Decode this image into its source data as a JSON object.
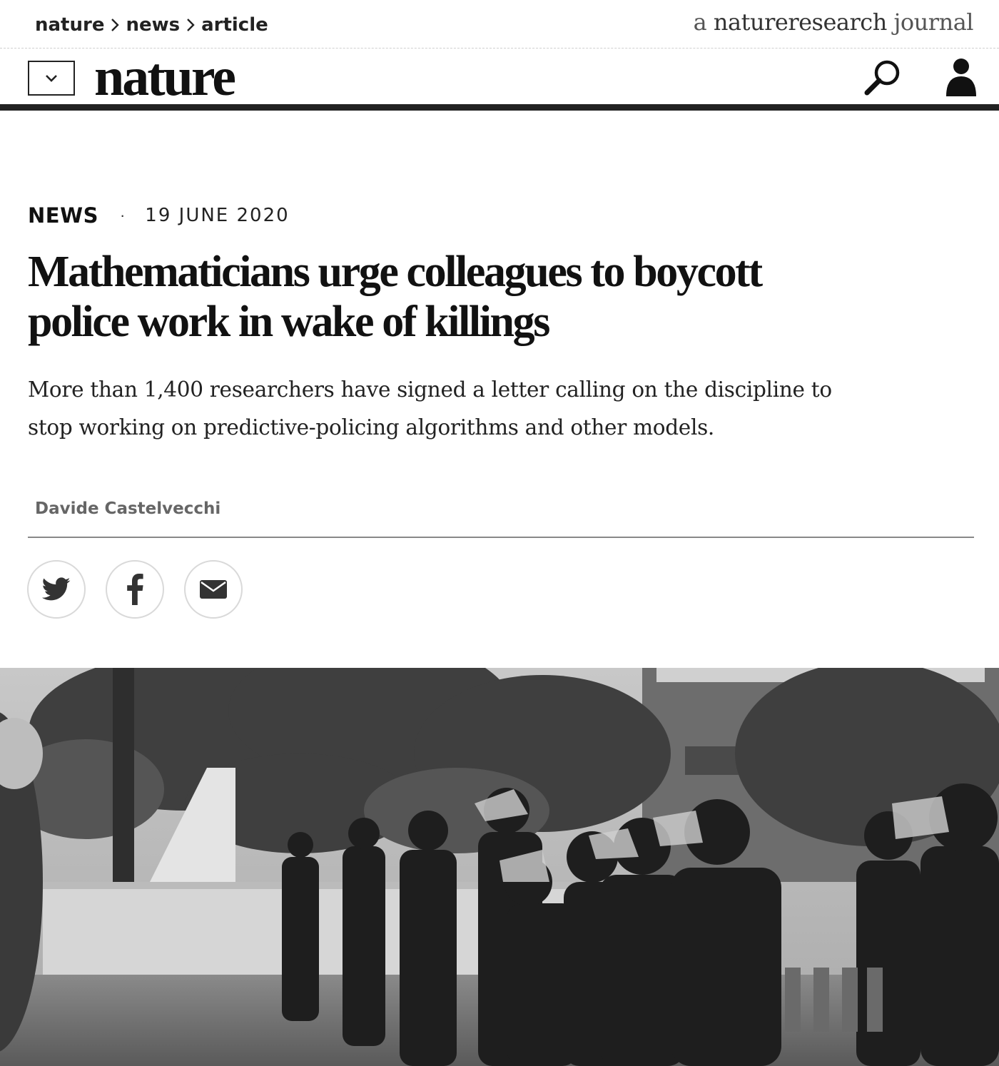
{
  "breadcrumb": {
    "items": [
      "nature",
      "news",
      "article"
    ],
    "separator": ">"
  },
  "tagline": {
    "prefix": "a",
    "brand": "natureresearch",
    "suffix": "journal"
  },
  "masthead": {
    "logo": "nature",
    "menu_icon": "chevron-down-icon",
    "search_icon": "search-icon",
    "user_icon": "user-icon"
  },
  "article": {
    "type": "NEWS",
    "separator": "·",
    "date": "19 JUNE 2020",
    "headline": "Mathematicians urge colleagues to boycott police work in wake of killings",
    "standfirst": "More than 1,400 researchers have signed a letter calling on the discipline to stop working on predictive-policing algorithms and other models.",
    "author": "Davide Castelvecchi"
  },
  "share": {
    "items": [
      {
        "icon": "twitter-icon"
      },
      {
        "icon": "facebook-icon"
      },
      {
        "icon": "email-icon"
      }
    ]
  },
  "hero": {
    "style": "black-and-white photograph"
  },
  "colors": {
    "text": "#222222",
    "rule": "#222222",
    "muted": "#666666"
  }
}
